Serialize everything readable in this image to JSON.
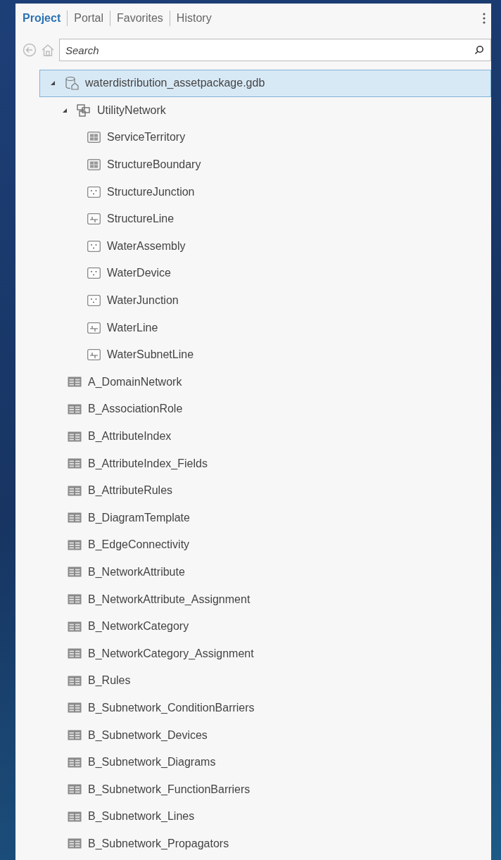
{
  "tabs": [
    {
      "label": "Project",
      "selected": true
    },
    {
      "label": "Portal",
      "selected": false
    },
    {
      "label": "Favorites",
      "selected": false
    },
    {
      "label": "History",
      "selected": false
    }
  ],
  "search": {
    "placeholder": "Search"
  },
  "tree": [
    {
      "label": "waterdistribution_assetpackage.gdb",
      "kind": "geodatabase",
      "selected": true,
      "expanded": true,
      "children": [
        {
          "label": "UtilityNetwork",
          "kind": "network",
          "selected": false,
          "expanded": true,
          "children": [
            {
              "label": "ServiceTerritory",
              "kind": "polygon",
              "selected": false
            },
            {
              "label": "StructureBoundary",
              "kind": "polygon",
              "selected": false
            },
            {
              "label": "StructureJunction",
              "kind": "point",
              "selected": false
            },
            {
              "label": "StructureLine",
              "kind": "line",
              "selected": false
            },
            {
              "label": "WaterAssembly",
              "kind": "point",
              "selected": false
            },
            {
              "label": "WaterDevice",
              "kind": "point",
              "selected": false
            },
            {
              "label": "WaterJunction",
              "kind": "point",
              "selected": false
            },
            {
              "label": "WaterLine",
              "kind": "line",
              "selected": false
            },
            {
              "label": "WaterSubnetLine",
              "kind": "line",
              "selected": false
            }
          ]
        },
        {
          "label": "A_DomainNetwork",
          "kind": "table",
          "selected": false
        },
        {
          "label": "B_AssociationRole",
          "kind": "table",
          "selected": false
        },
        {
          "label": "B_AttributeIndex",
          "kind": "table",
          "selected": false
        },
        {
          "label": "B_AttributeIndex_Fields",
          "kind": "table",
          "selected": false
        },
        {
          "label": "B_AttributeRules",
          "kind": "table",
          "selected": false
        },
        {
          "label": "B_DiagramTemplate",
          "kind": "table",
          "selected": false
        },
        {
          "label": "B_EdgeConnectivity",
          "kind": "table",
          "selected": false
        },
        {
          "label": "B_NetworkAttribute",
          "kind": "table",
          "selected": false
        },
        {
          "label": "B_NetworkAttribute_Assignment",
          "kind": "table",
          "selected": false
        },
        {
          "label": "B_NetworkCategory",
          "kind": "table",
          "selected": false
        },
        {
          "label": "B_NetworkCategory_Assignment",
          "kind": "table",
          "selected": false
        },
        {
          "label": "B_Rules",
          "kind": "table",
          "selected": false
        },
        {
          "label": "B_Subnetwork_ConditionBarriers",
          "kind": "table",
          "selected": false
        },
        {
          "label": "B_Subnetwork_Devices",
          "kind": "table",
          "selected": false
        },
        {
          "label": "B_Subnetwork_Diagrams",
          "kind": "table",
          "selected": false
        },
        {
          "label": "B_Subnetwork_FunctionBarriers",
          "kind": "table",
          "selected": false
        },
        {
          "label": "B_Subnetwork_Lines",
          "kind": "table",
          "selected": false
        },
        {
          "label": "B_Subnetwork_Propagators",
          "kind": "table",
          "selected": false
        }
      ]
    }
  ]
}
